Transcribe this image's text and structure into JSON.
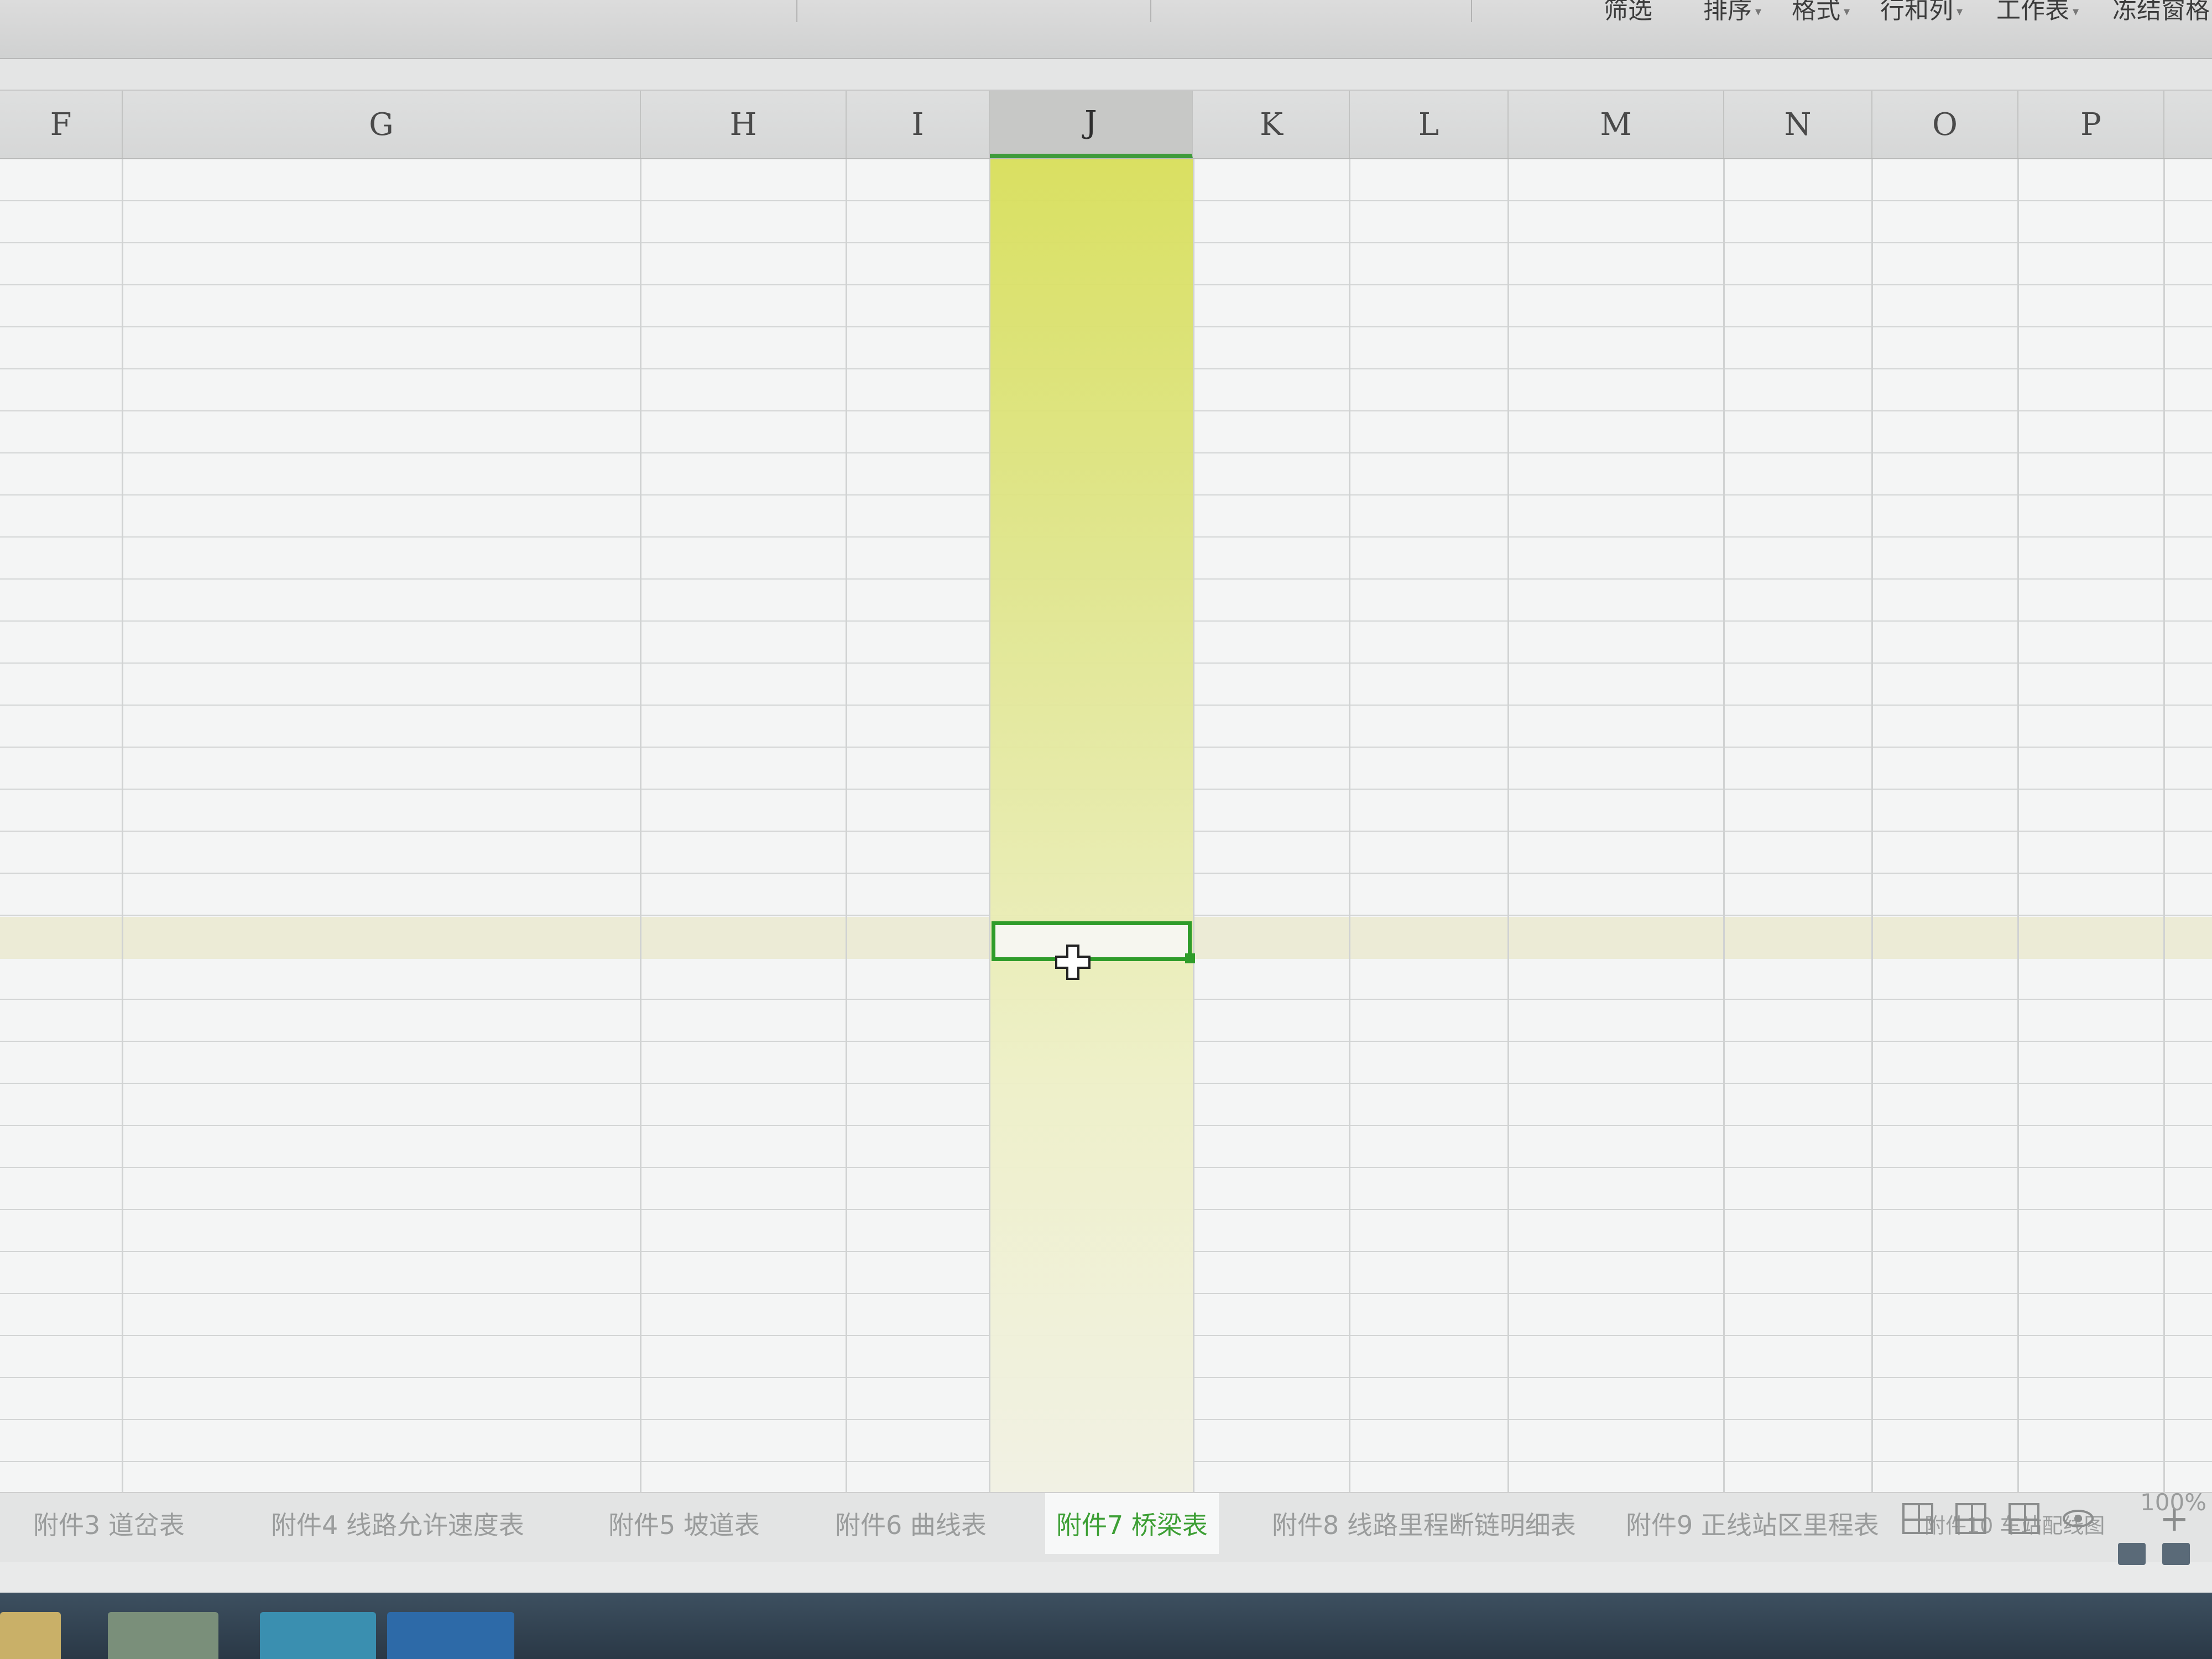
{
  "ribbon": {
    "items": [
      {
        "label": "筛选",
        "caret": ""
      },
      {
        "label": "排序",
        "caret": "▾"
      },
      {
        "label": "格式",
        "caret": "▾"
      },
      {
        "label": "行和列",
        "caret": "▾"
      },
      {
        "label": "工作表",
        "caret": "▾"
      },
      {
        "label": "冻结窗格",
        "caret": ""
      }
    ]
  },
  "columns": [
    "F",
    "G",
    "H",
    "I",
    "J",
    "K",
    "L",
    "M",
    "N",
    "O",
    "P"
  ],
  "selected_column": "J",
  "sheet_tabs": [
    {
      "label": "附件3 道岔表",
      "active": false
    },
    {
      "label": "附件4 线路允许速度表",
      "active": false
    },
    {
      "label": "附件5 坡道表",
      "active": false
    },
    {
      "label": "附件6 曲线表",
      "active": false
    },
    {
      "label": "附件7 桥梁表",
      "active": true
    },
    {
      "label": "附件8 线路里程断链明细表",
      "active": false
    },
    {
      "label": "附件9 正线站区里程表",
      "active": false
    },
    {
      "label": "附件10 车站配线图",
      "active": false
    }
  ],
  "add_tab_label": "+",
  "zoom": "100%",
  "colors": {
    "accent": "#2f9c2a",
    "selection": "#dfe58a"
  }
}
